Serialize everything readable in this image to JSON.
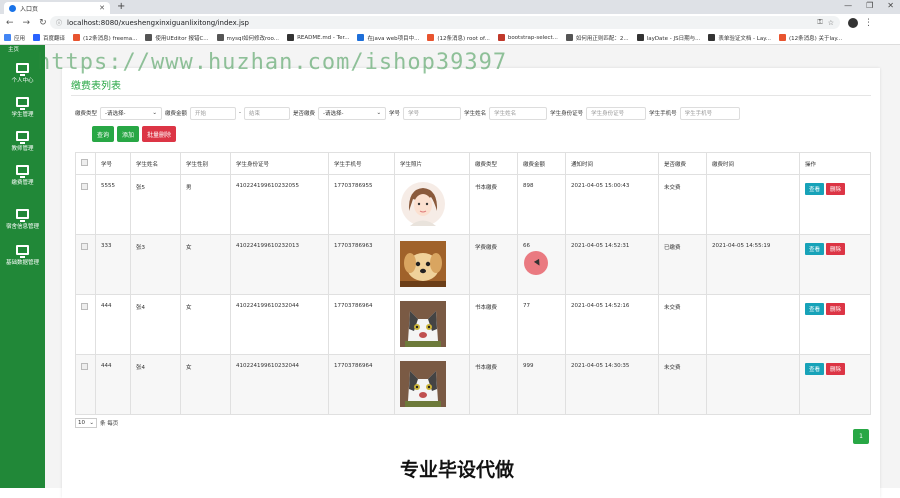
{
  "browser": {
    "tab_title": "入口页",
    "url": "localhost:8080/xueshengxinxiguanlixitong/index.jsp",
    "bookmarks": [
      {
        "label": "应用",
        "color": "#4285f4"
      },
      {
        "label": "百度翻译",
        "color": "#2962ff"
      },
      {
        "label": "(12条消息) freema...",
        "color": "#e8542f"
      },
      {
        "label": "使用UEditor 报错C...",
        "color": "#555555"
      },
      {
        "label": "mysql如何修改roo...",
        "color": "#555555"
      },
      {
        "label": "README.md - Ter...",
        "color": "#333333"
      },
      {
        "label": "在java web项目中...",
        "color": "#1e6fd9"
      },
      {
        "label": "(12条消息) root of...",
        "color": "#e8542f"
      },
      {
        "label": "bootstrap-select...",
        "color": "#c0392b"
      },
      {
        "label": "如何用正则匹配：2...",
        "color": "#555555"
      },
      {
        "label": "layDate - JS日期与...",
        "color": "#333333"
      },
      {
        "label": "表单验证文档 - Lay...",
        "color": "#333333"
      },
      {
        "label": "(12条消息) 关于lay...",
        "color": "#e8542f"
      }
    ]
  },
  "sidebar": {
    "top_label": "主页",
    "items": [
      {
        "label": "个人中心"
      },
      {
        "label": "学生管理"
      },
      {
        "label": "教师管理"
      },
      {
        "label": "缴费管理"
      },
      {
        "label": "宿舍信息管理"
      },
      {
        "label": "基础数据管理"
      }
    ]
  },
  "panel": {
    "title": "缴费表列表"
  },
  "filters": {
    "type_label": "缴费类型",
    "type_select": "-请选择-",
    "amount_label": "缴费金额",
    "amount_start_placeholder": "开始",
    "range_sep": "-",
    "amount_end_placeholder": "结束",
    "paid_label": "是否缴费",
    "paid_select": "-请选择-",
    "no_label": "学号",
    "no_placeholder": "学号",
    "name_label": "学生姓名",
    "name_placeholder": "学生姓名",
    "id_label": "学生身份证号",
    "id_placeholder": "学生身份证号",
    "phone_label": "学生手机号",
    "phone_placeholder": "学生手机号"
  },
  "actions": {
    "query": "查询",
    "add": "添加",
    "batch_delete": "批量删除"
  },
  "table": {
    "headers": [
      "学号",
      "学生姓名",
      "学生性别",
      "学生身份证号",
      "学生手机号",
      "学生照片",
      "缴费类型",
      "缴费金额",
      "通知时间",
      "是否缴费",
      "缴费时间",
      "操作"
    ],
    "view_label": "查看",
    "delete_label": "删除",
    "rows": [
      {
        "no": "5555",
        "name": "张5",
        "gender": "男",
        "idcard": "410224199610232055",
        "phone": "17703786955",
        "photo": "girl-avatar",
        "type": "书本缴费",
        "amount": "898",
        "notice": "2021-04-05 15:00:43",
        "paid": "未交费",
        "paytime": ""
      },
      {
        "no": "333",
        "name": "张3",
        "gender": "女",
        "idcard": "410224199610232013",
        "phone": "17703786963",
        "photo": "puppy-photo",
        "type": "学费缴费",
        "amount": "66",
        "notice": "2021-04-05 14:52:31",
        "paid": "已缴费",
        "paytime": "2021-04-05 14:55:19"
      },
      {
        "no": "444",
        "name": "张4",
        "gender": "女",
        "idcard": "410224199610232044",
        "phone": "17703786964",
        "photo": "cat-photo",
        "type": "书本缴费",
        "amount": "77",
        "notice": "2021-04-05 14:52:16",
        "paid": "未交费",
        "paytime": ""
      },
      {
        "no": "444",
        "name": "张4",
        "gender": "女",
        "idcard": "410224199610232044",
        "phone": "17703786964",
        "photo": "cat-photo",
        "type": "书本缴费",
        "amount": "999",
        "notice": "2021-04-05 14:30:35",
        "paid": "未交费",
        "paytime": ""
      }
    ]
  },
  "pager": {
    "page_size": "10",
    "per_page_label": "条 每页",
    "current_page": "1"
  },
  "overlay": {
    "watermark": "https://www.huzhan.com/ishop39397",
    "caption": "专业毕设代做"
  }
}
